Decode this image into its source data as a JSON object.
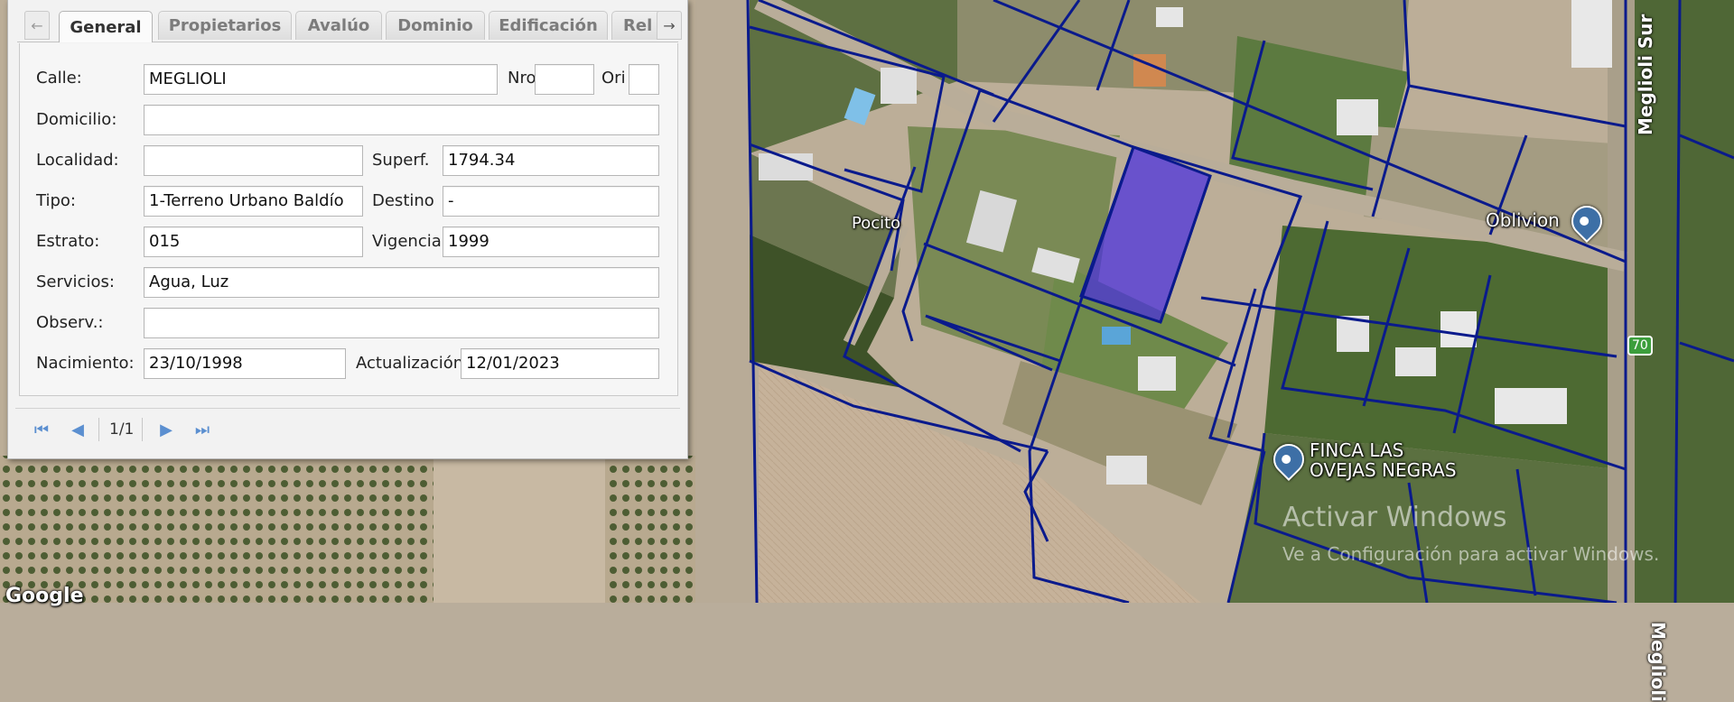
{
  "tabs": [
    "General",
    "Propietarios",
    "Avalúo",
    "Dominio",
    "Edificación",
    "Rel"
  ],
  "active_tab": "General",
  "form": {
    "calle_label": "Calle:",
    "calle_value": "MEGLIOLI",
    "nro_label": "Nro",
    "nro_value": "",
    "ori_label": "Ori",
    "ori_value": "",
    "domicilio_label": "Domicilio:",
    "domicilio_value": "",
    "localidad_label": "Localidad:",
    "localidad_value": "",
    "superf_label": "Superf.",
    "superf_value": "1794.34",
    "tipo_label": "Tipo:",
    "tipo_value": "1-Terreno Urbano Baldío",
    "destino_label": "Destino",
    "destino_value": "-",
    "estrato_label": "Estrato:",
    "estrato_value": "015",
    "vigencia_label": "Vigencia",
    "vigencia_value": "1999",
    "servicios_label": "Servicios:",
    "servicios_value": "Agua, Luz",
    "observ_label": "Observ.:",
    "observ_value": "",
    "nacimiento_label": "Nacimiento:",
    "nacimiento_value": "23/10/1998",
    "actualizacion_label": "Actualización",
    "actualizacion_value": "12/01/2023"
  },
  "pager": {
    "text": "1/1"
  },
  "map": {
    "place_pocito": "Pocito",
    "place_oblivion": "Oblivion",
    "place_finca": "FINCA LAS\nOVEJAS NEGRAS",
    "road_meglioli_sur": "Meglioli Sur",
    "road_meglioli": "Meglioli",
    "route_badge": "70",
    "watermark_line1": "Activar Windows",
    "watermark_line2": "Ve a Configuración para activar Windows.",
    "google_logo": "Google",
    "parcel_line_color": "#0a1a8c",
    "selected_parcel_color": "#4a2fe0"
  }
}
